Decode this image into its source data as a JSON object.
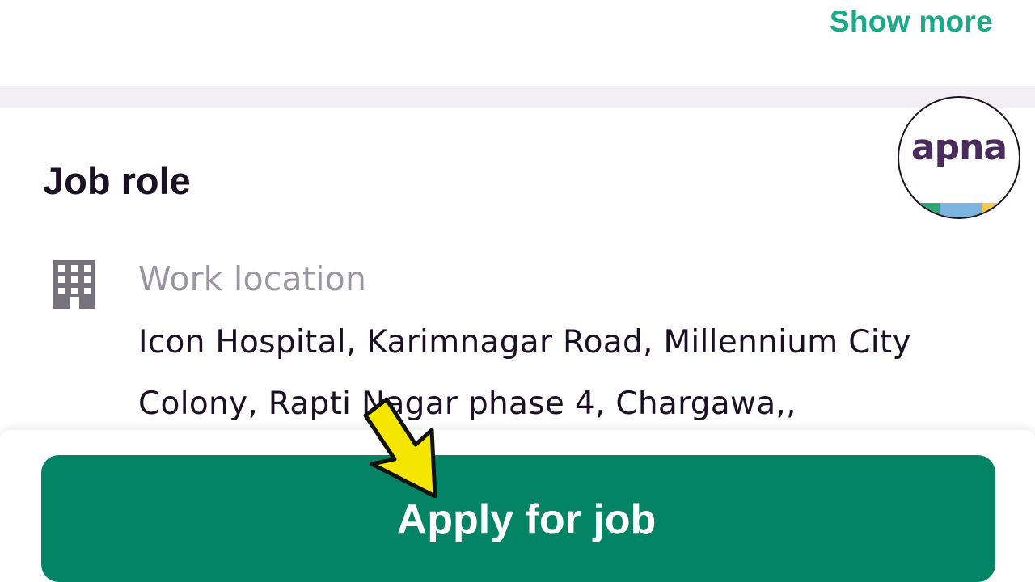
{
  "header": {
    "show_more_label": "Show more"
  },
  "job_role": {
    "title": "Job role",
    "location_icon": "building-icon",
    "work_location_label": "Work location",
    "work_location_value": "Icon Hospital, Karimnagar Road, Millennium City Colony, Rapti Nagar phase 4, Chargawa,,"
  },
  "footer": {
    "apply_label": "Apply for job"
  },
  "overlay": {
    "logo_text": "apna",
    "arrow_icon": "pointer-arrow-icon"
  },
  "colors": {
    "accent": "#1aaa8a",
    "button": "#038565",
    "text_dark": "#1b1024",
    "text_muted": "#9b97a2",
    "arrow": "#f5e600",
    "logo_text": "#4a2c5c"
  }
}
